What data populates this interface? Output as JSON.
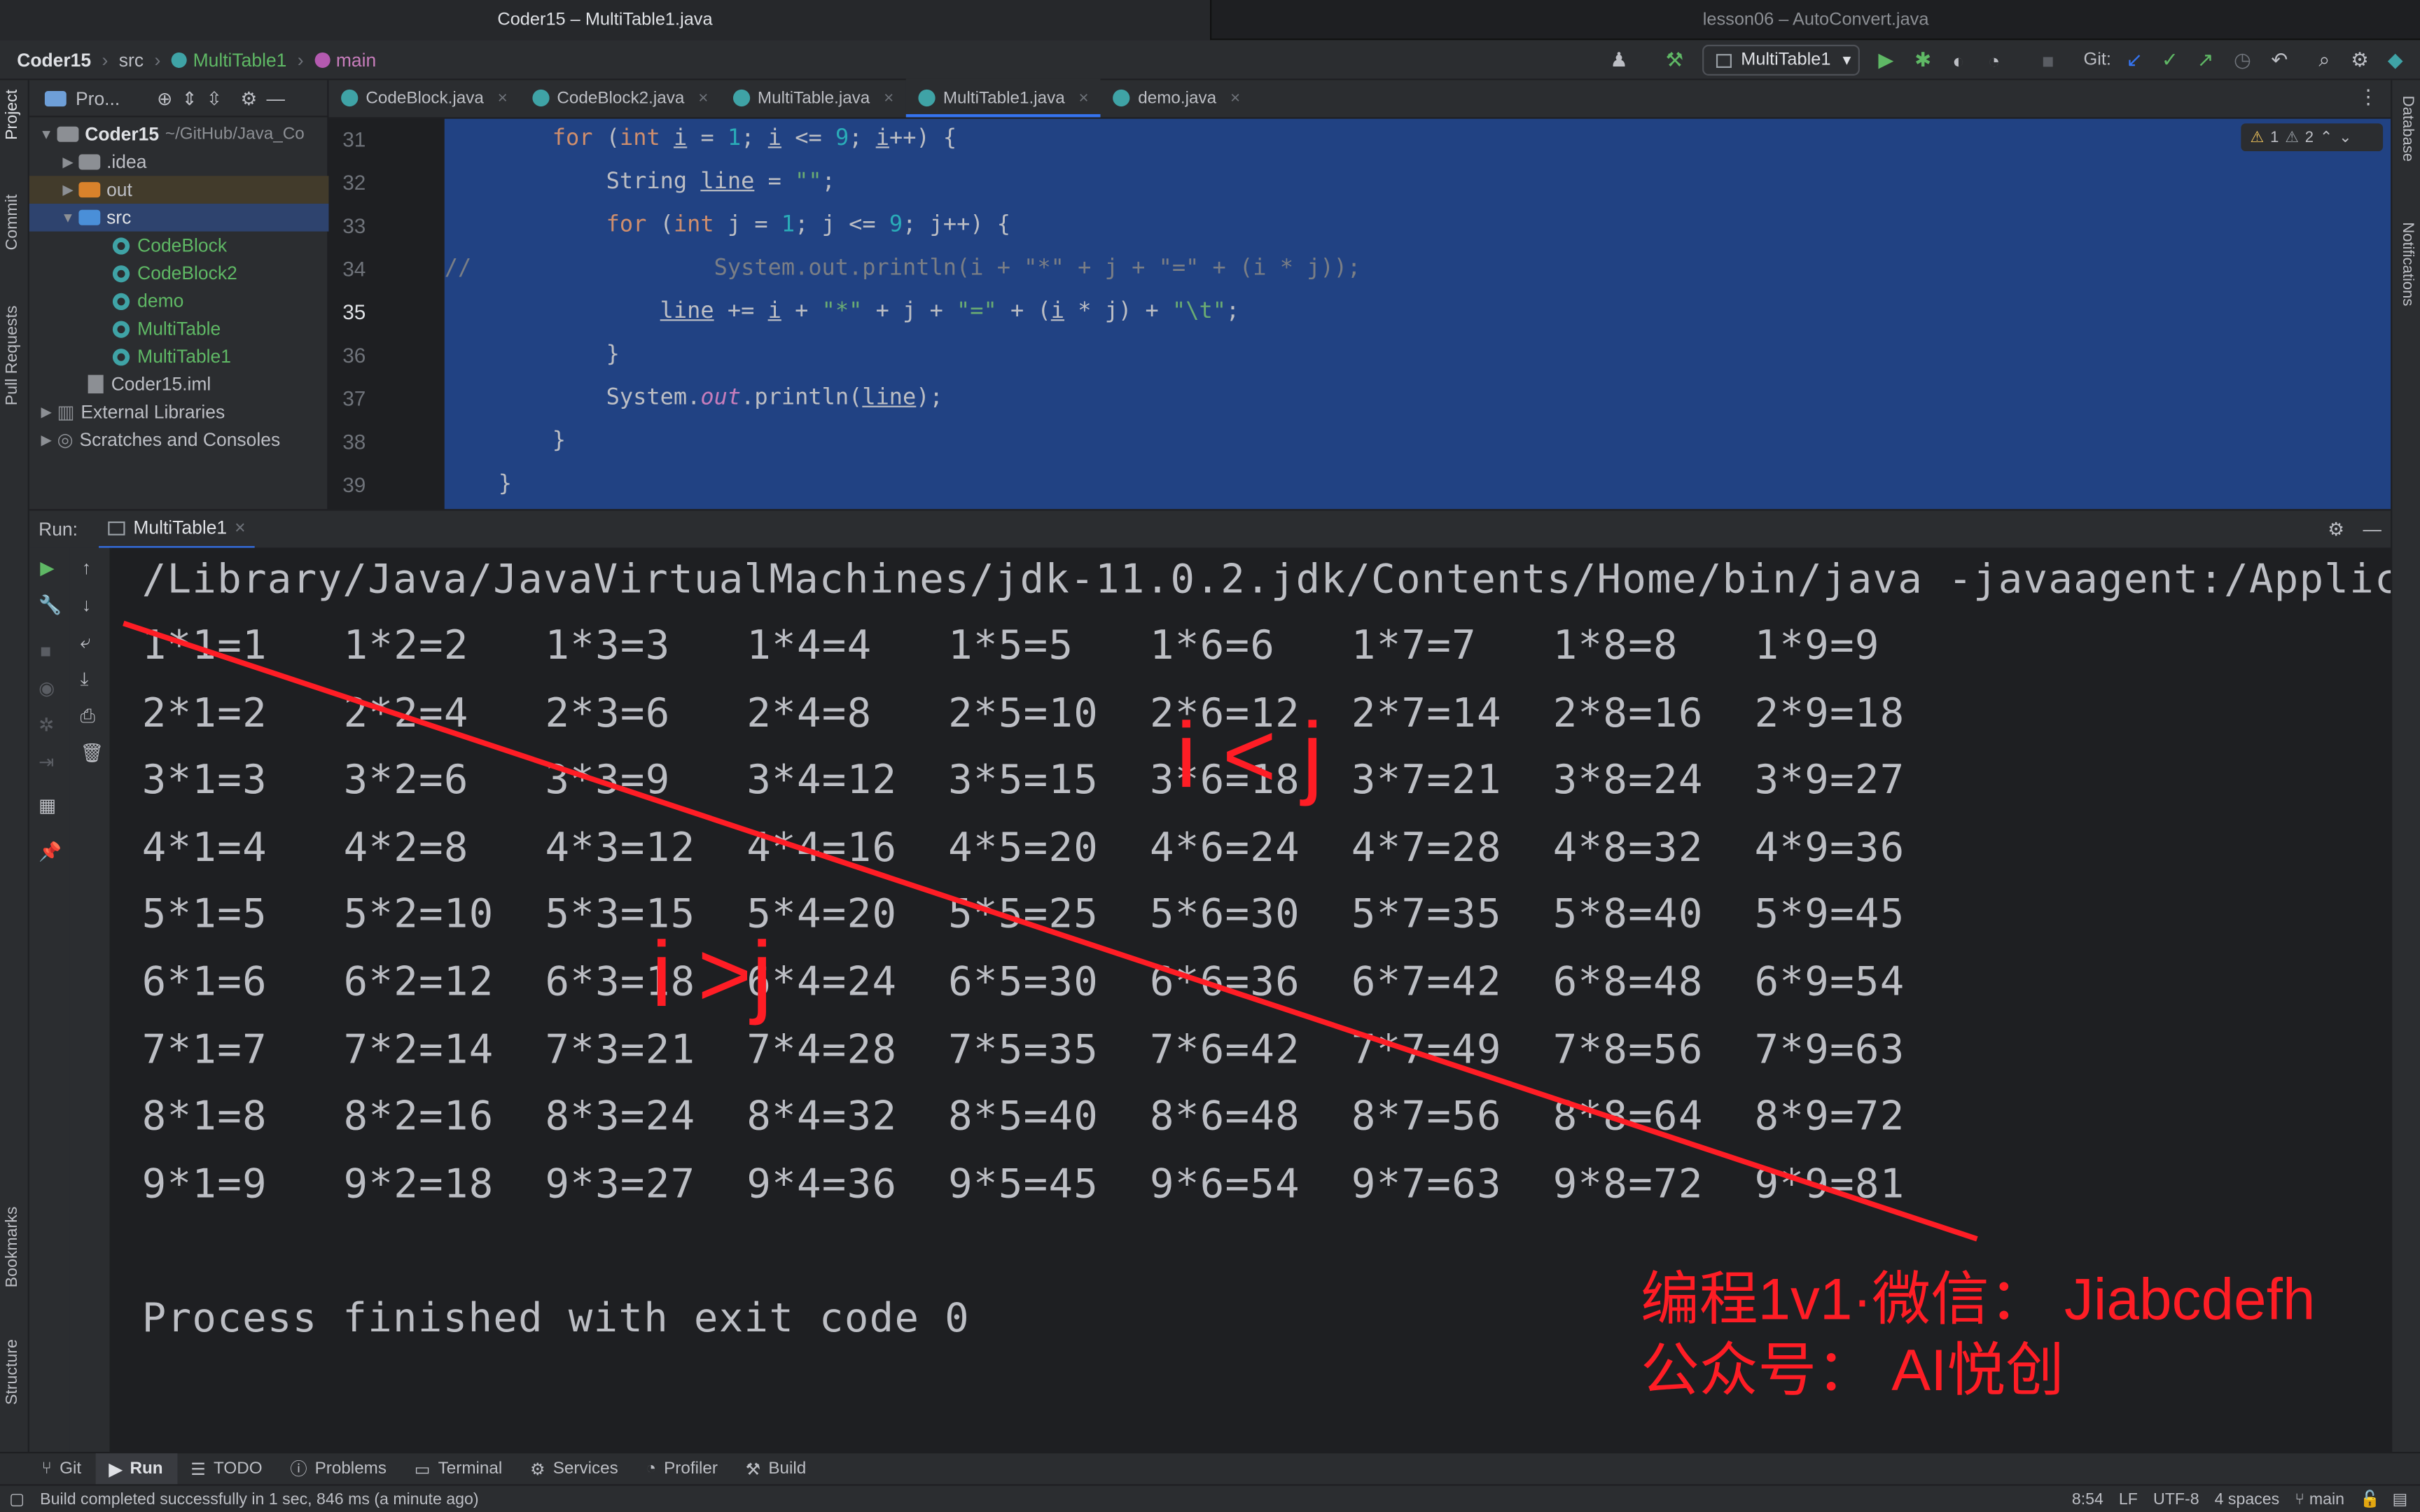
{
  "window_tabs": [
    "Coder15 – MultiTable1.java",
    "lesson06 – AutoConvert.java"
  ],
  "breadcrumb": {
    "project": "Coder15",
    "folder": "src",
    "class": "MultiTable1",
    "method": "main"
  },
  "toolbar": {
    "run_config": "MultiTable1",
    "git_label": "Git:"
  },
  "left_strip": [
    "Project",
    "Commit",
    "Pull Requests",
    "Bookmarks",
    "Structure"
  ],
  "right_strip": [
    "Database",
    "Notifications"
  ],
  "project_panel": {
    "title": "Pro...",
    "root": "Coder15",
    "root_path": "~/GitHub/Java_Co",
    "items": [
      ".idea",
      "out",
      "src",
      "CodeBlock",
      "CodeBlock2",
      "demo",
      "MultiTable",
      "MultiTable1",
      "Coder15.iml",
      "External Libraries",
      "Scratches and Consoles"
    ]
  },
  "editor_tabs": [
    "CodeBlock.java",
    "CodeBlock2.java",
    "MultiTable.java",
    "MultiTable1.java",
    "demo.java"
  ],
  "inspections": {
    "warnings": "1",
    "weak": "2"
  },
  "line_numbers": [
    "31",
    "32",
    "33",
    "34",
    "35",
    "36",
    "37",
    "38",
    "39"
  ],
  "run_panel": {
    "label": "Run:",
    "tab": "MultiTable1"
  },
  "console": {
    "command": "/Library/Java/JavaVirtualMachines/jdk-11.0.2.jdk/Contents/Home/bin/java -javaagent:/Applic",
    "table": [
      [
        "1*1=1",
        "1*2=2",
        "1*3=3",
        "1*4=4",
        "1*5=5",
        "1*6=6",
        "1*7=7",
        "1*8=8",
        "1*9=9"
      ],
      [
        "2*1=2",
        "2*2=4",
        "2*3=6",
        "2*4=8",
        "2*5=10",
        "2*6=12",
        "2*7=14",
        "2*8=16",
        "2*9=18"
      ],
      [
        "3*1=3",
        "3*2=6",
        "3*3=9",
        "3*4=12",
        "3*5=15",
        "3*6=18",
        "3*7=21",
        "3*8=24",
        "3*9=27"
      ],
      [
        "4*1=4",
        "4*2=8",
        "4*3=12",
        "4*4=16",
        "4*5=20",
        "4*6=24",
        "4*7=28",
        "4*8=32",
        "4*9=36"
      ],
      [
        "5*1=5",
        "5*2=10",
        "5*3=15",
        "5*4=20",
        "5*5=25",
        "5*6=30",
        "5*7=35",
        "5*8=40",
        "5*9=45"
      ],
      [
        "6*1=6",
        "6*2=12",
        "6*3=18",
        "6*4=24",
        "6*5=30",
        "6*6=36",
        "6*7=42",
        "6*8=48",
        "6*9=54"
      ],
      [
        "7*1=7",
        "7*2=14",
        "7*3=21",
        "7*4=28",
        "7*5=35",
        "7*6=42",
        "7*7=49",
        "7*8=56",
        "7*9=63"
      ],
      [
        "8*1=8",
        "8*2=16",
        "8*3=24",
        "8*4=32",
        "8*5=40",
        "8*6=48",
        "8*7=56",
        "8*8=64",
        "8*9=72"
      ],
      [
        "9*1=9",
        "9*2=18",
        "9*3=27",
        "9*4=36",
        "9*5=45",
        "9*6=54",
        "9*7=63",
        "9*8=72",
        "9*9=81"
      ]
    ],
    "finish": "Process finished with exit code 0"
  },
  "annotations": {
    "upper": "i < j",
    "lower": "i >j",
    "promo_line1": "编程1v1·微信： Jiabcdefh",
    "promo_line2": "公众号： AI悦创"
  },
  "bottom_tabs": [
    "Git",
    "Run",
    "TODO",
    "Problems",
    "Terminal",
    "Services",
    "Profiler",
    "Build"
  ],
  "status": {
    "message": "Build completed successfully in 1 sec, 846 ms (a minute ago)",
    "position": "8:54",
    "line_sep": "LF",
    "encoding": "UTF-8",
    "indent": "4 spaces",
    "branch": "main"
  },
  "colors": {
    "accent": "#3574f0",
    "selection": "#214283",
    "annotation_red": "#ff1d25"
  }
}
